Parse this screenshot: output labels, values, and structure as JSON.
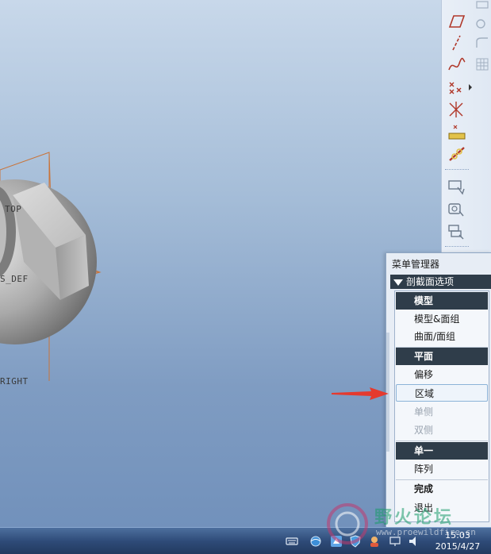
{
  "viewport": {
    "datum_labels": {
      "top": "TOP",
      "front": "S_DEF",
      "right": "RIGHT"
    }
  },
  "toolbar": {
    "buttons": [
      {
        "icon": "datum-plane-icon"
      },
      {
        "icon": "datum-axis-icon"
      },
      {
        "icon": "datum-curve-icon"
      },
      {
        "icon": "datum-point-icon"
      },
      {
        "icon": "coordinate-system-icon"
      },
      {
        "icon": "analysis-feature-icon"
      },
      {
        "icon": "sketch-icon"
      },
      {
        "icon": "copy-geometry-icon"
      },
      {
        "icon": "surface-icon"
      },
      {
        "icon": "shrinkwrap-icon"
      }
    ]
  },
  "menu_manager": {
    "title": "菜单管理器",
    "header": "剖截面选项",
    "items": [
      {
        "label": "模型",
        "kind": "section"
      },
      {
        "label": "模型&面组",
        "kind": "item"
      },
      {
        "label": "曲面/面组",
        "kind": "item"
      },
      {
        "label": "平面",
        "kind": "section"
      },
      {
        "label": "偏移",
        "kind": "item"
      },
      {
        "label": "区域",
        "kind": "hover"
      },
      {
        "label": "单侧",
        "kind": "disabled"
      },
      {
        "label": "双侧",
        "kind": "disabled"
      },
      {
        "label": "单一",
        "kind": "section"
      },
      {
        "label": "阵列",
        "kind": "item"
      },
      {
        "label": "完成",
        "kind": "bold"
      },
      {
        "label": "退出",
        "kind": "item"
      }
    ]
  },
  "taskbar": {
    "time": "15:03",
    "date": "2015/4/27"
  },
  "watermark": {
    "text": "野火论坛",
    "url": "www.proewildfire.cn"
  },
  "colors": {
    "accent_red": "#e53a2e",
    "menu_section_bg": "#2f3d4a",
    "datum_orange": "#c9743a"
  }
}
